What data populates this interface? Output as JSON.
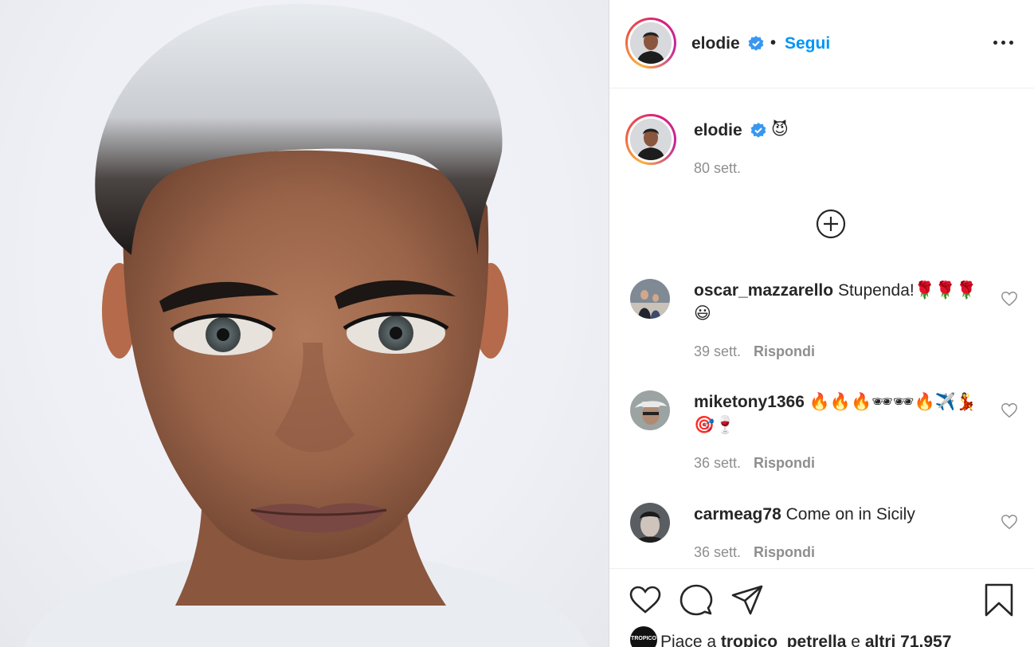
{
  "post": {
    "author": "elodie",
    "follow_label": "Segui",
    "separator": "•",
    "more_label": "Altre opzioni"
  },
  "caption": {
    "author": "elodie",
    "emoji": "😈",
    "time": "80 sett."
  },
  "comments": [
    {
      "user": "oscar_mazzarello",
      "text": "Stupenda!🌹🌹🌹😃",
      "time": "39 sett.",
      "reply": "Rispondi"
    },
    {
      "user": "miketony1366",
      "text": "🔥🔥🔥🕶🕶🔥✈️💃🎯🍷",
      "time": "36 sett.",
      "reply": "Rispondi"
    },
    {
      "user": "carmeag78",
      "text": "Come on in Sicily",
      "time": "36 sett.",
      "reply": "Rispondi"
    }
  ],
  "likes": {
    "prefix": "Piace a",
    "first_user": "tropico_petrella",
    "middle": "e",
    "others": "altri 71.957",
    "liker_avatar_text": "TROPICO"
  },
  "icons": {
    "verified": "verified-badge-icon",
    "more": "more-options-icon",
    "load_more": "plus-circle-icon",
    "comment_like": "heart-icon",
    "like": "heart-icon",
    "comment": "comment-icon",
    "share": "share-icon",
    "save": "bookmark-icon"
  },
  "colors": {
    "link": "#0095f6",
    "verified": "#3897f0",
    "secondary_text": "#8e8e8e",
    "border": "#dbdbdb"
  }
}
